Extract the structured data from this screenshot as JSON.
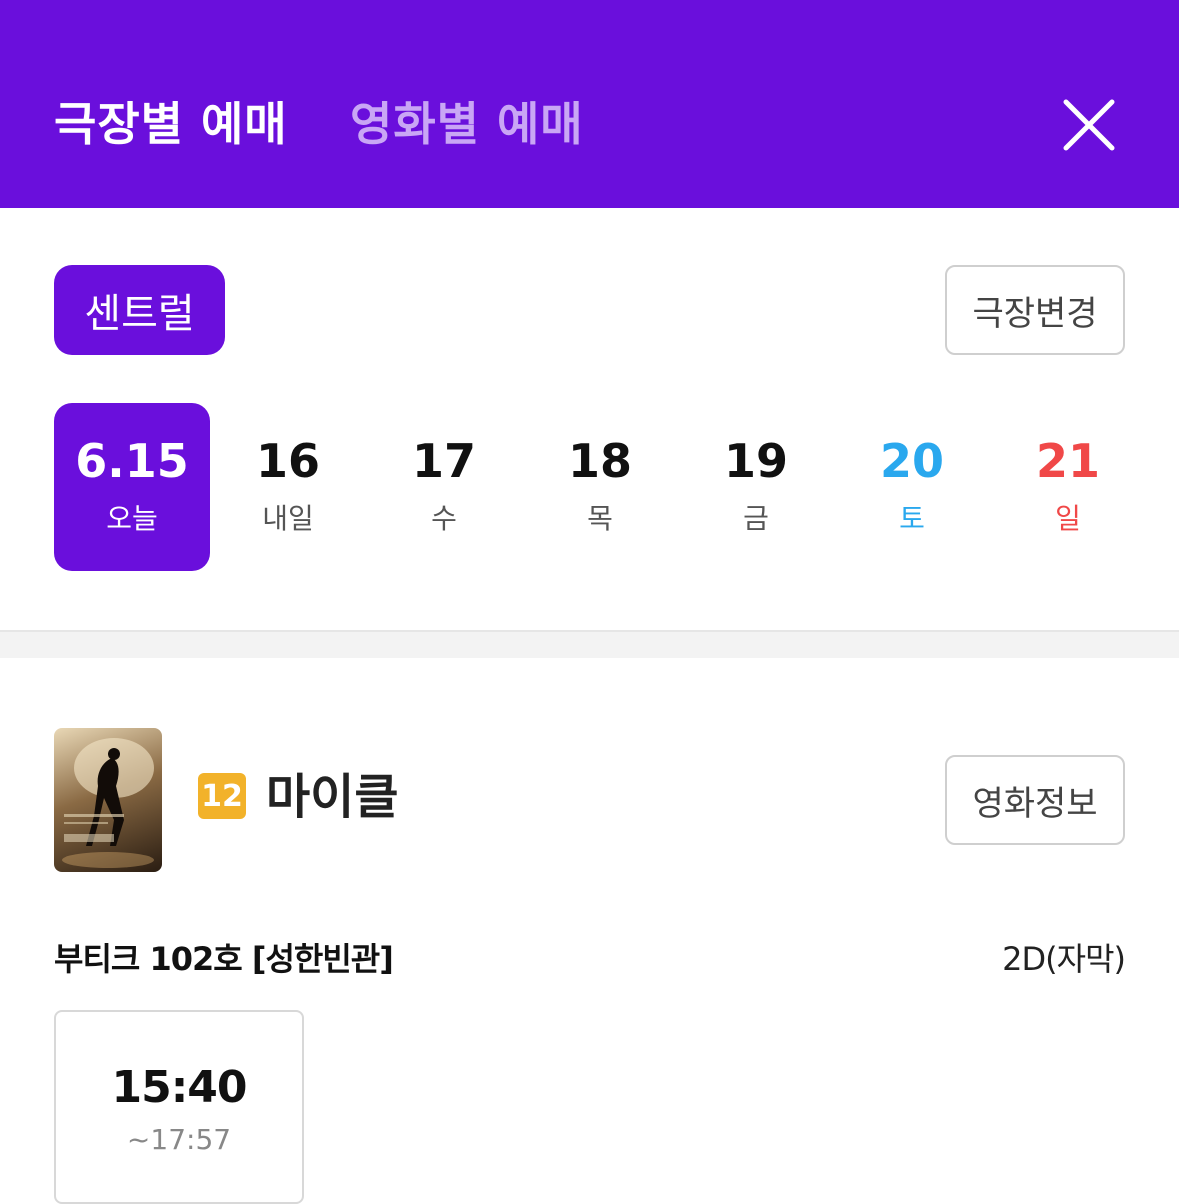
{
  "header": {
    "tabs": [
      {
        "label": "극장별 예매",
        "active": true
      },
      {
        "label": "영화별 예매",
        "active": false
      }
    ],
    "close_icon": "close-icon",
    "background_color": "#6a0fdc"
  },
  "theater": {
    "selected_label": "센트럴",
    "change_label": "극장변경"
  },
  "dates": [
    {
      "num": "6.15",
      "day": "오늘",
      "state": "selected"
    },
    {
      "num": "16",
      "day": "내일",
      "state": "normal"
    },
    {
      "num": "17",
      "day": "수",
      "state": "normal"
    },
    {
      "num": "18",
      "day": "목",
      "state": "normal"
    },
    {
      "num": "19",
      "day": "금",
      "state": "normal"
    },
    {
      "num": "20",
      "day": "토",
      "state": "saturday"
    },
    {
      "num": "21",
      "day": "일",
      "state": "sunday"
    }
  ],
  "movie": {
    "rating": "12",
    "title": "마이클",
    "info_label": "영화정보",
    "poster_icon": "movie-poster"
  },
  "screening": {
    "hall": "부티크 102호 [성한빈관]",
    "format": "2D(자막)",
    "times": [
      {
        "start": "15:40",
        "end": "~17:57"
      }
    ]
  }
}
